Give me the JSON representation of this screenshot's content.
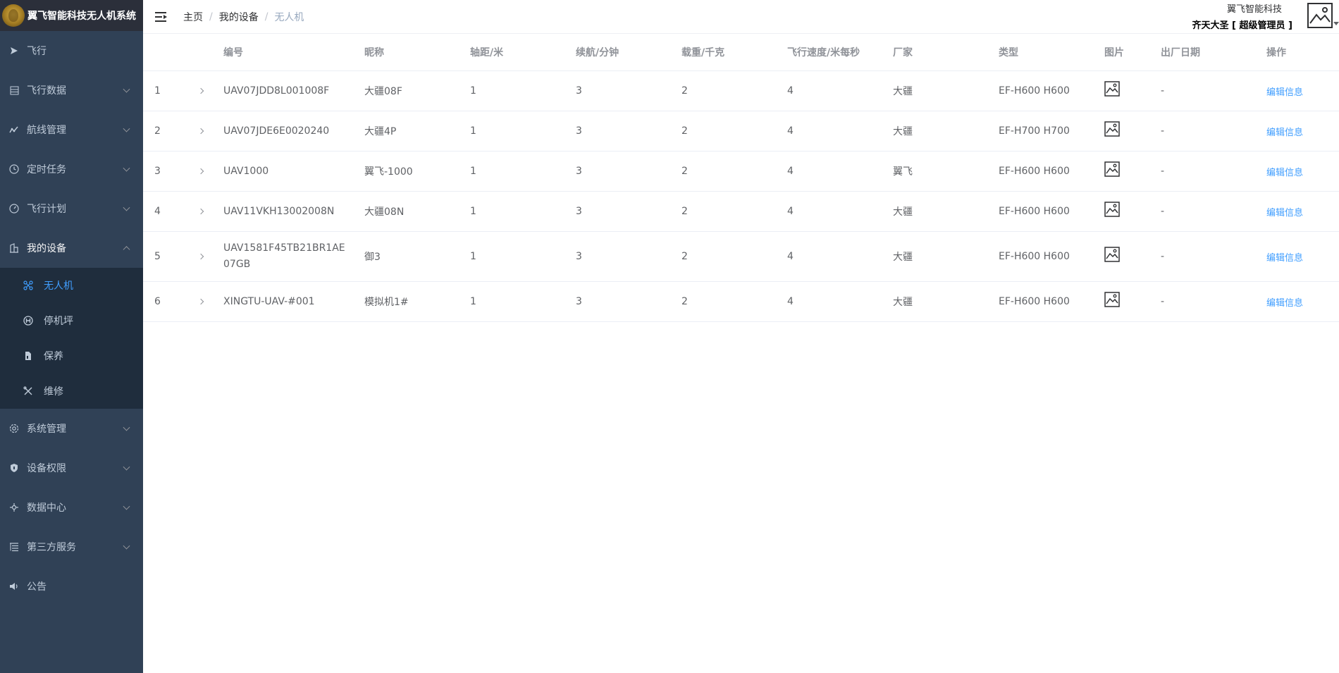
{
  "app": {
    "title": "翼飞智能科技无人机系统"
  },
  "sidebar": {
    "items": [
      {
        "label": "飞行",
        "icon": "send-icon"
      },
      {
        "label": "飞行数据",
        "icon": "table-icon"
      },
      {
        "label": "航线管理",
        "icon": "chart-line-icon"
      },
      {
        "label": "定时任务",
        "icon": "clock-icon"
      },
      {
        "label": "飞行计划",
        "icon": "dashboard-icon"
      },
      {
        "label": "我的设备",
        "icon": "device-icon"
      },
      {
        "label": "系统管理",
        "icon": "gear-icon"
      },
      {
        "label": "设备权限",
        "icon": "shield-icon"
      },
      {
        "label": "数据中心",
        "icon": "asterisk-icon"
      },
      {
        "label": "第三方服务",
        "icon": "tree-list-icon"
      },
      {
        "label": "公告",
        "icon": "speaker-icon"
      }
    ],
    "device_sub": [
      {
        "label": "无人机",
        "icon": "drone-icon"
      },
      {
        "label": "停机坪",
        "icon": "helipad-icon"
      },
      {
        "label": "保养",
        "icon": "document-icon"
      },
      {
        "label": "维修",
        "icon": "tools-icon"
      }
    ]
  },
  "header": {
    "breadcrumb": [
      "主页",
      "我的设备",
      "无人机"
    ],
    "company": "翼飞智能科技",
    "username": "齐天大圣 [ 超级管理员 ]"
  },
  "table": {
    "columns": [
      "编号",
      "昵称",
      "轴距/米",
      "续航/分钟",
      "载重/千克",
      "飞行速度/米每秒",
      "厂家",
      "类型",
      "图片",
      "出厂日期",
      "操作"
    ],
    "rows": [
      {
        "idx": "1",
        "num": "UAV07JDD8L001008F",
        "nick": "大疆08F",
        "axis": "1",
        "endurance": "3",
        "load": "2",
        "speed": "4",
        "maker": "大疆",
        "type": "EF-H600 H600",
        "date": "-",
        "op": "编辑信息"
      },
      {
        "idx": "2",
        "num": "UAV07JDE6E0020240",
        "nick": "大疆4P",
        "axis": "1",
        "endurance": "3",
        "load": "2",
        "speed": "4",
        "maker": "大疆",
        "type": "EF-H700 H700",
        "date": "-",
        "op": "编辑信息"
      },
      {
        "idx": "3",
        "num": "UAV1000",
        "nick": "翼飞-1000",
        "axis": "1",
        "endurance": "3",
        "load": "2",
        "speed": "4",
        "maker": "翼飞",
        "type": "EF-H600 H600",
        "date": "-",
        "op": "编辑信息"
      },
      {
        "idx": "4",
        "num": "UAV11VKH13002008N",
        "nick": "大疆08N",
        "axis": "1",
        "endurance": "3",
        "load": "2",
        "speed": "4",
        "maker": "大疆",
        "type": "EF-H600 H600",
        "date": "-",
        "op": "编辑信息"
      },
      {
        "idx": "5",
        "num": "UAV1581F45TB21BR1AE07GB",
        "nick": "御3",
        "axis": "1",
        "endurance": "3",
        "load": "2",
        "speed": "4",
        "maker": "大疆",
        "type": "EF-H600 H600",
        "date": "-",
        "op": "编辑信息"
      },
      {
        "idx": "6",
        "num": "XINGTU-UAV-#001",
        "nick": "模拟机1#",
        "axis": "1",
        "endurance": "3",
        "load": "2",
        "speed": "4",
        "maker": "大疆",
        "type": "EF-H600 H600",
        "date": "-",
        "op": "编辑信息"
      }
    ]
  },
  "colors": {
    "sidebar_bg": "#304156",
    "submenu_bg": "#1f2d3d",
    "active": "#409eff",
    "link": "#409eff"
  }
}
